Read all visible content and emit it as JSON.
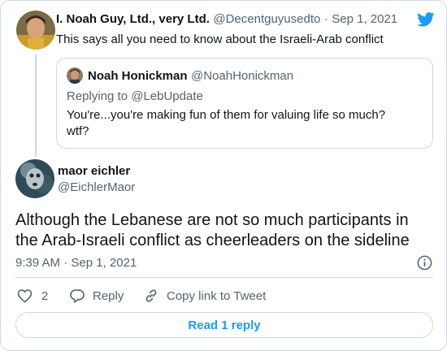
{
  "parent_tweet": {
    "display_name": "I. Noah Guy, Ltd., very Ltd.",
    "handle": "@Decentguyusedto",
    "separator": "·",
    "date": "Sep 1, 2021",
    "text": "This says all you need to know about the Israeli-Arab conflict"
  },
  "quoted_tweet": {
    "display_name": "Noah Honickman",
    "handle": "@NoahHonickman",
    "reply_prefix": "Replying to ",
    "reply_to": "@LebUpdate",
    "text_line1": "You're...you're making fun of them for valuing life so much?",
    "text_line2": "wtf?"
  },
  "main_tweet": {
    "display_name": "maor eichler",
    "handle": "@EichlerMaor",
    "text_line1": "Although the Lebanese are not so much participants in",
    "text_line2": "the Arab-Israeli conflict as cheerleaders on the sideline",
    "time": "9:39 AM",
    "separator": "·",
    "date": "Sep 1, 2021"
  },
  "actions": {
    "like_count": "2",
    "reply_label": "Reply",
    "copy_label": "Copy link to Tweet"
  },
  "read_replies_label": "Read 1 reply",
  "colors": {
    "accent": "#1d9bf0",
    "muted": "#536471",
    "border": "#cfd9de",
    "text": "#0f1419"
  },
  "icons": [
    "twitter-bird-icon",
    "info-icon",
    "heart-icon",
    "reply-icon",
    "link-icon"
  ]
}
